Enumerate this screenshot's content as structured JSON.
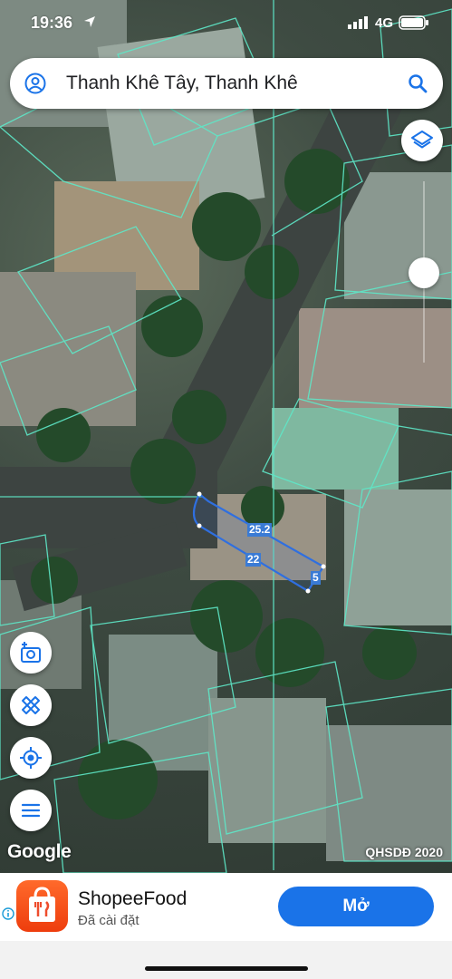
{
  "status_bar": {
    "time": "19:36",
    "network": "4G"
  },
  "search": {
    "query": "Thanh Khê Tây, Thanh Khê"
  },
  "map": {
    "measurements": [
      "25.2",
      "22",
      "5"
    ],
    "logo": "Google",
    "credit": "QHSDĐ 2020"
  },
  "ad": {
    "app_name": "ShopeeFood",
    "app_status": "Đã cài đặt",
    "open_label": "Mở"
  },
  "colors": {
    "accent": "#1a73e8",
    "parcel_lines": "#5ee8c8",
    "measure_line": "#2f6fe0",
    "ad_icon": "#ee4d2d"
  },
  "icons": {
    "account": "account-circle-icon",
    "search": "search-icon",
    "layers": "layers-icon",
    "camera": "add-photo-icon",
    "measure": "ruler-pencil-icon",
    "location": "my-location-icon",
    "menu": "menu-icon"
  }
}
